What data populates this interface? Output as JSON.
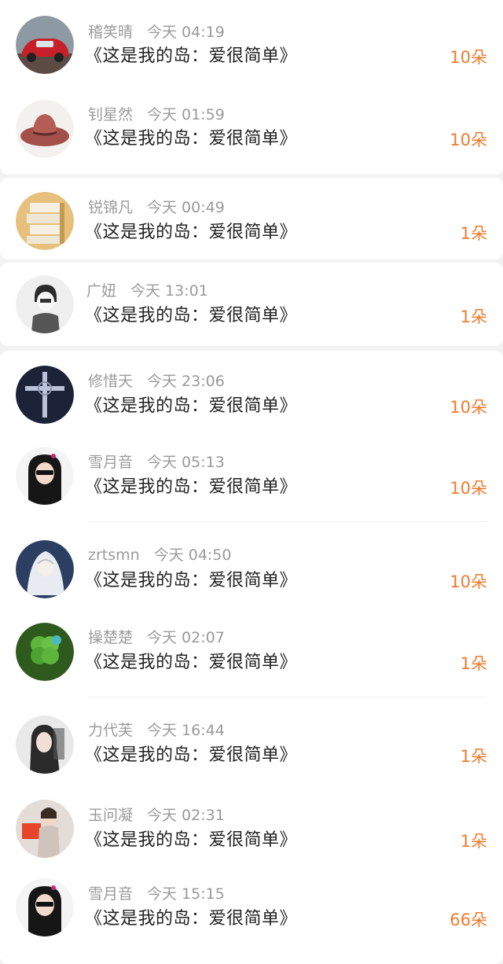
{
  "colors": {
    "accent": "#f07a2c",
    "meta_text": "#9a9a9a",
    "title_text": "#222222",
    "background": "#f2f2f2",
    "card": "#ffffff"
  },
  "records": [
    {
      "user": "稽笑晴",
      "time": "今天 04:19",
      "title": "《这是我的岛：爱很简单》",
      "amount": "10朵",
      "avatar_icon": "red-vintage-car-avatar"
    },
    {
      "user": "钊星然",
      "time": "今天 01:59",
      "title": "《这是我的岛：爱很简单》",
      "amount": "10朵",
      "avatar_icon": "cowboy-hat-avatar"
    },
    {
      "user": "锐锦凡",
      "time": "今天 00:49",
      "title": "《这是我的岛：爱很简单》",
      "amount": "1朵",
      "avatar_icon": "books-avatar"
    },
    {
      "user": "广妞",
      "time": "今天 13:01",
      "title": "《这是我的岛：爱很简单》",
      "amount": "1朵",
      "avatar_icon": "sketch-boy-avatar"
    },
    {
      "user": "修惜天",
      "time": "今天 23:06",
      "title": "《这是我的岛：爱很简单》",
      "amount": "10朵",
      "avatar_icon": "dark-cross-avatar"
    },
    {
      "user": "雪月音",
      "time": "今天 05:13",
      "title": "《这是我的岛：爱很简单》",
      "amount": "10朵",
      "avatar_icon": "girl-sunglasses-avatar"
    },
    {
      "user": "zrtsmn",
      "time": "今天 04:50",
      "title": "《这是我的岛：爱很简单》",
      "amount": "10朵",
      "avatar_icon": "anime-girl-avatar"
    },
    {
      "user": "操楚楚",
      "time": "今天 02:07",
      "title": "《这是我的岛：爱很简单》",
      "amount": "1朵",
      "avatar_icon": "clover-avatar"
    },
    {
      "user": "力代芙",
      "time": "今天 16:44",
      "title": "《这是我的岛：爱很简单》",
      "amount": "1朵",
      "avatar_icon": "woman-portrait-avatar"
    },
    {
      "user": "玉问凝",
      "time": "今天 02:31",
      "title": "《这是我的岛：爱很简单》",
      "amount": "1朵",
      "avatar_icon": "fashion-girl-avatar"
    },
    {
      "user": "雪月音",
      "time": "今天 15:15",
      "title": "《这是我的岛：爱很简单》",
      "amount": "66朵",
      "avatar_icon": "girl-sunglasses-avatar"
    }
  ]
}
